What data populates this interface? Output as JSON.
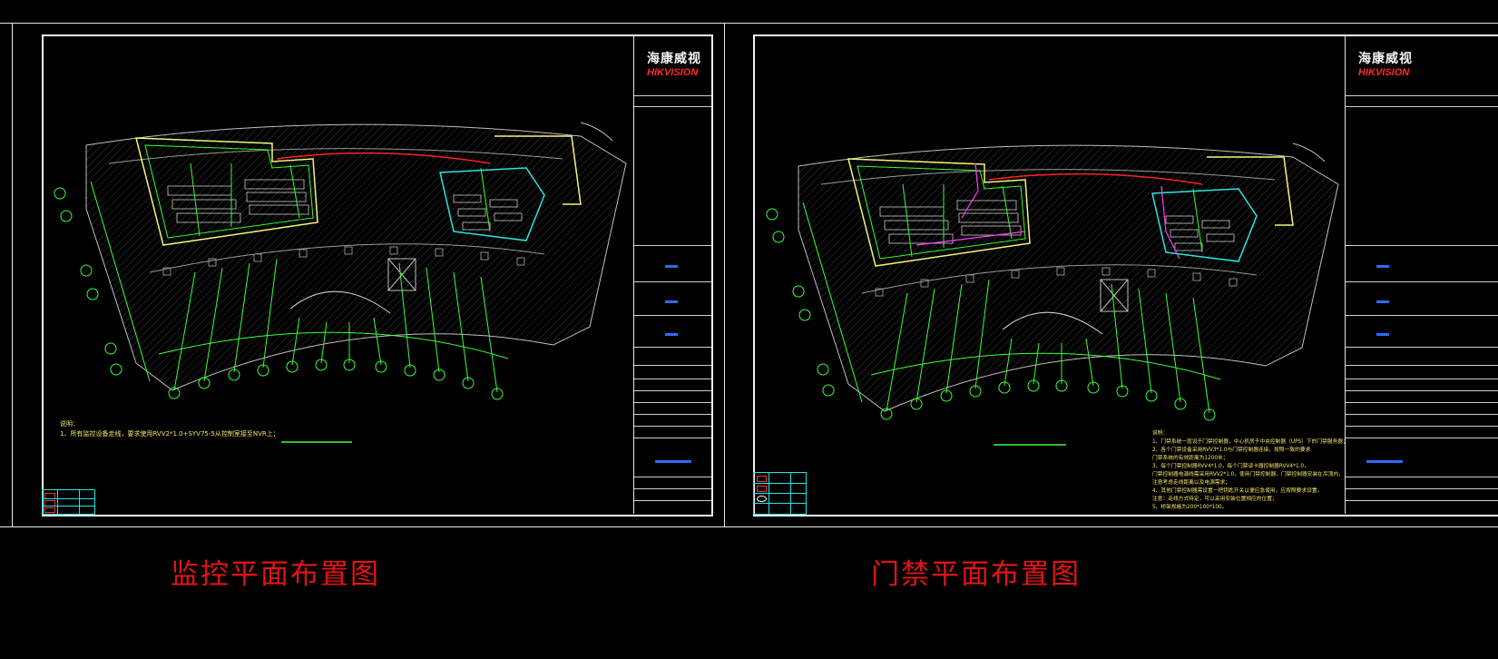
{
  "drawings": [
    {
      "id": "surveillance",
      "title": "监控平面布置图",
      "brand": {
        "cn": "海康威视",
        "en": "HIKVISION"
      },
      "notes": [
        "说明：",
        "1、所有监控设备走线，要求使用RVV2*1.0+SYV75-5从控制室接至NVR上；"
      ]
    },
    {
      "id": "access_control",
      "title": "门禁平面布置图",
      "brand": {
        "cn": "海康威视",
        "en": "HIKVISION"
      },
      "notes": [
        "说明：",
        "1、门禁系统一层设于门禁控制器，中心机房于中央控制器（UPS）下的门禁服务器；",
        "2、各个门禁设备采用RVV3*1.0与门禁控制器连接，按照一致的要求",
        "   门禁系统的有效距离为1200米；",
        "3、每个门禁控制器RVV4*1.0，每个门禁读卡器控制器RVV4*1.0，",
        "   门禁控制器电源线需采用RVV2*1.0，使用门禁控制器，门禁控制器安装在吊顶内，",
        "   注意考虑走线距离以及电源需求；",
        "4、其他门禁控制器需设置一把钥匙开关以便应急使用，应按照要求设置，",
        "   注意：走线方式待定，可以采用安装位置相应的位置；",
        "5、桥架规格为200*100*100。"
      ]
    }
  ]
}
